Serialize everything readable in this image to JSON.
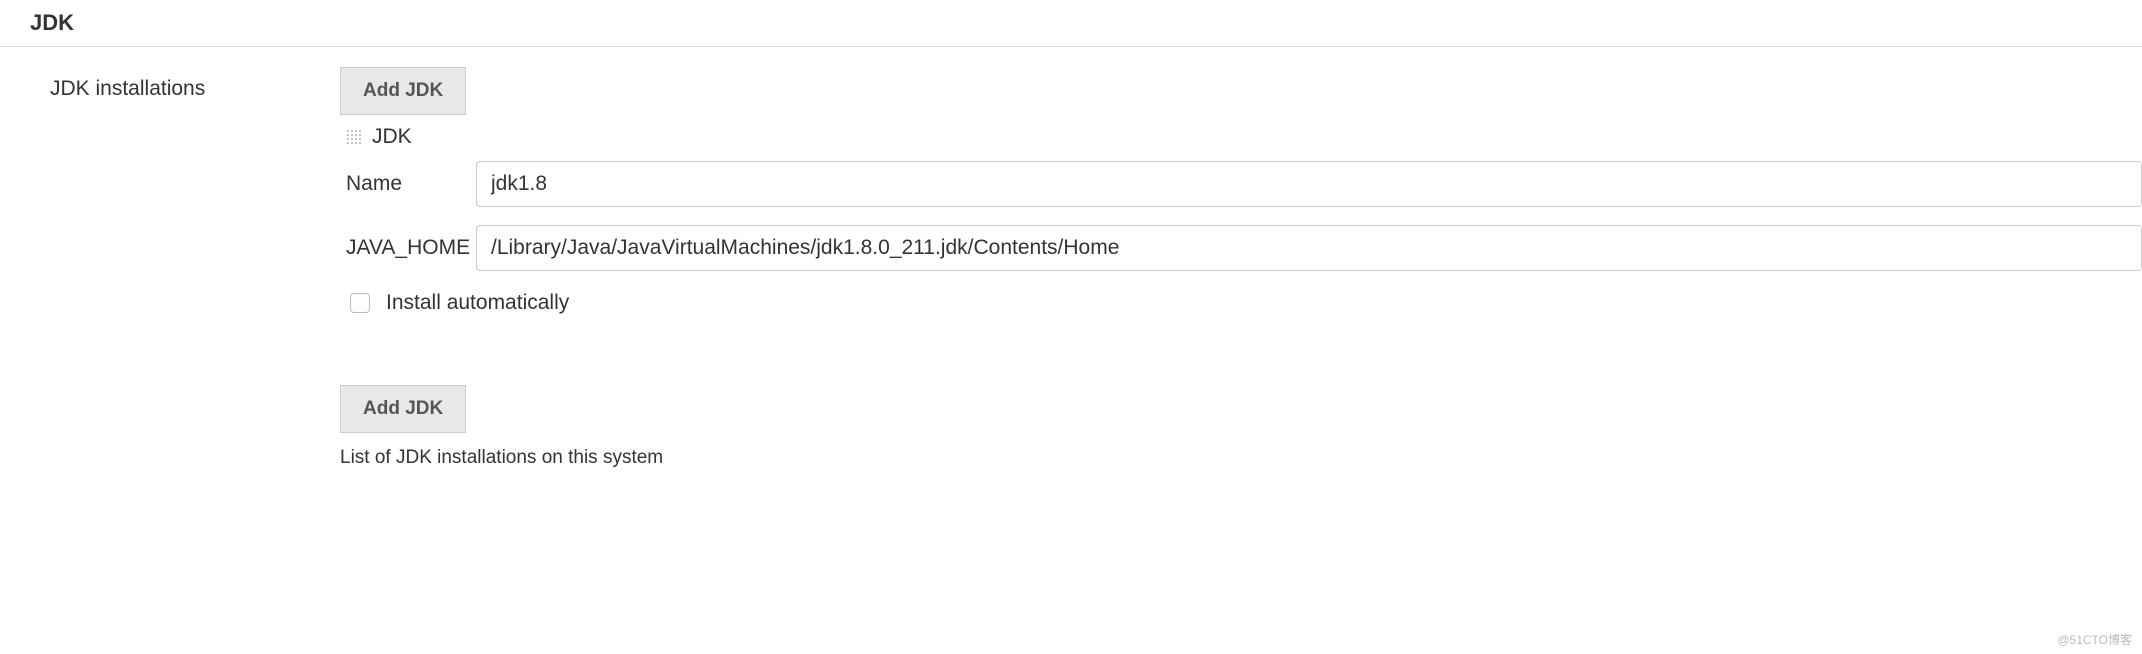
{
  "section": {
    "title": "JDK",
    "left_label": "JDK installations",
    "add_button_top": "Add JDK",
    "add_button_bottom": "Add JDK",
    "help_text": "List of JDK installations on this system"
  },
  "jdk_entry": {
    "header": "JDK",
    "name_label": "Name",
    "name_value": "jdk1.8",
    "java_home_label": "JAVA_HOME",
    "java_home_value": "/Library/Java/JavaVirtualMachines/jdk1.8.0_211.jdk/Contents/Home",
    "install_auto_label": "Install automatically",
    "install_auto_checked": false
  },
  "watermark": "@51CTO博客"
}
